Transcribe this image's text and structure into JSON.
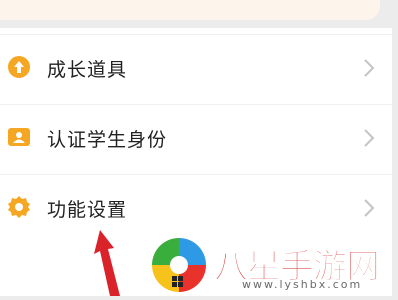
{
  "menu": {
    "items": [
      {
        "label": "成长道具",
        "icon": "upload-coin-icon"
      },
      {
        "label": "认证学生身份",
        "icon": "id-card-icon"
      },
      {
        "label": "功能设置",
        "icon": "gear-icon"
      }
    ]
  },
  "watermark": {
    "text": "八星手游网",
    "url": "www.lyshbx.com"
  },
  "colors": {
    "icon_orange": "#f5a623",
    "watermark_red": "#d52b2b",
    "arrow_red": "#d9222a"
  }
}
